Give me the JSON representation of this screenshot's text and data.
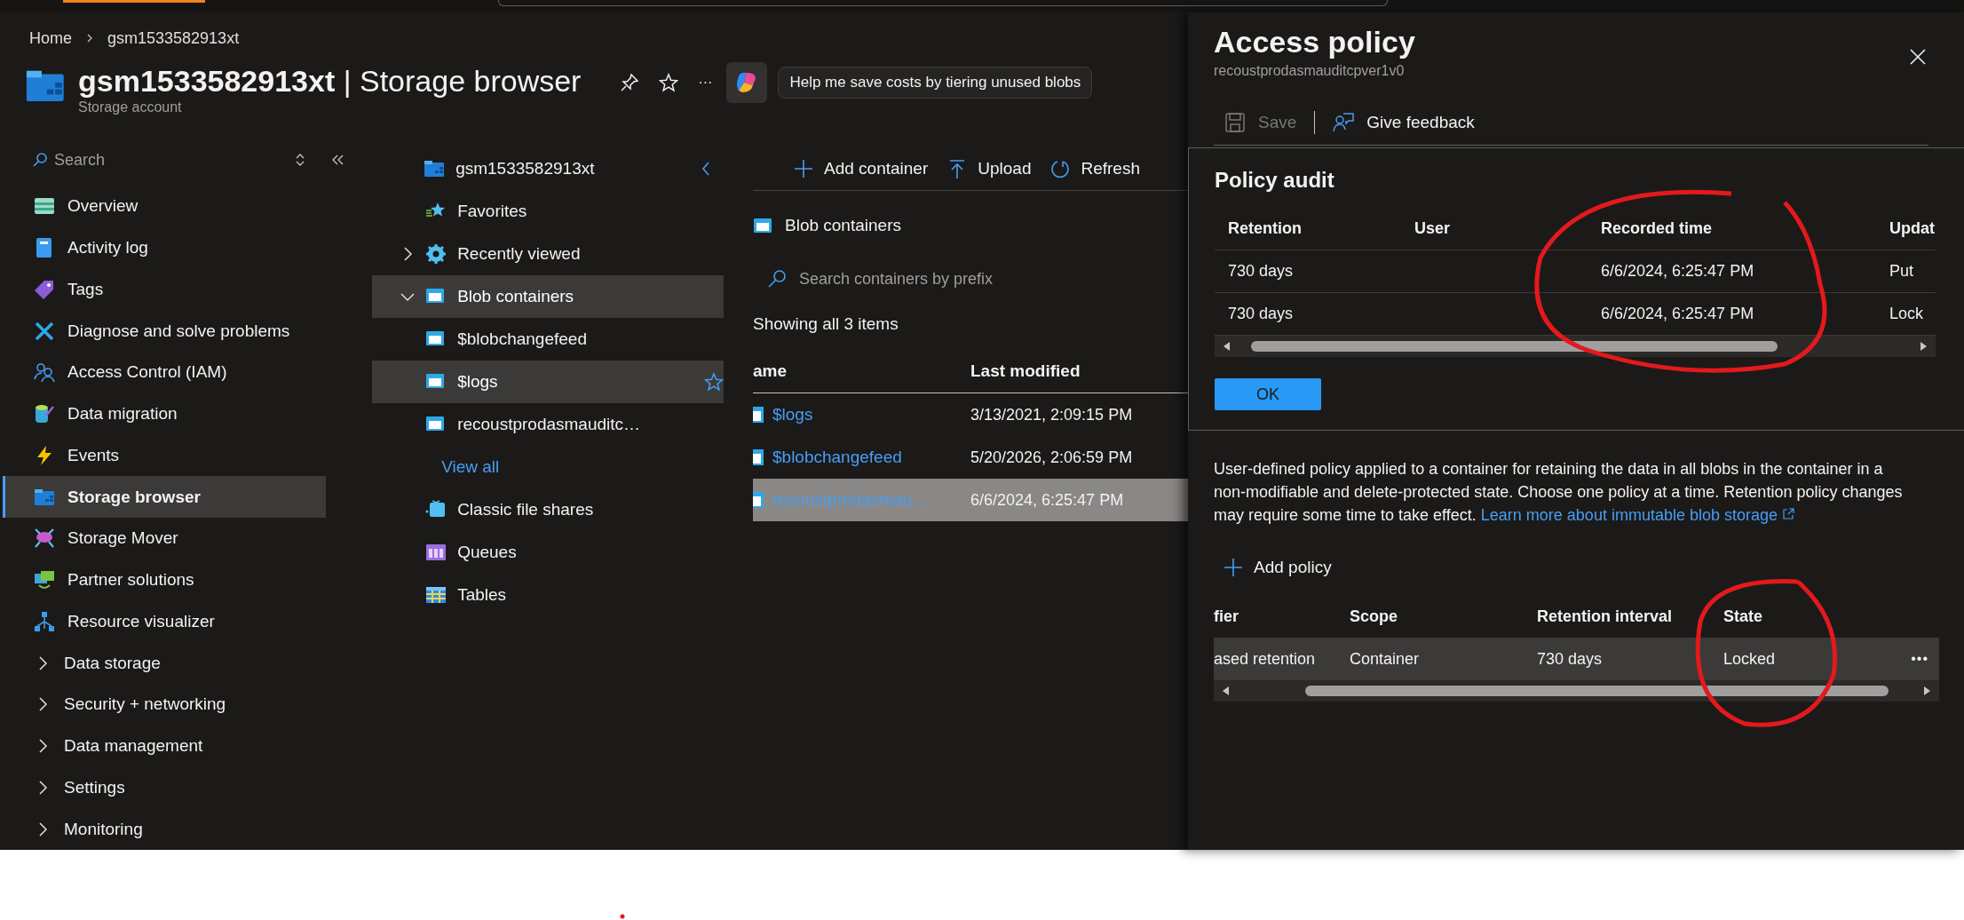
{
  "breadcrumb": [
    {
      "label": "Home"
    },
    {
      "label": "gsm1533582913xt"
    }
  ],
  "header": {
    "title_bold": "gsm1533582913xt",
    "title_rest": "| Storage browser",
    "subtitle": "Storage account",
    "ellipsis": "···",
    "suggestion": "Help me save costs by tiering unused blobs"
  },
  "sidebar": {
    "search": {
      "placeholder": "Search"
    },
    "items": [
      {
        "label": "Overview",
        "kind": "link",
        "selected": false
      },
      {
        "label": "Activity log",
        "kind": "link",
        "selected": false
      },
      {
        "label": "Tags",
        "kind": "link",
        "selected": false
      },
      {
        "label": "Diagnose and solve problems",
        "kind": "link",
        "selected": false
      },
      {
        "label": "Access Control (IAM)",
        "kind": "link",
        "selected": false
      },
      {
        "label": "Data migration",
        "kind": "link",
        "selected": false
      },
      {
        "label": "Events",
        "kind": "link",
        "selected": false
      },
      {
        "label": "Storage browser",
        "kind": "link",
        "selected": true
      },
      {
        "label": "Storage Mover",
        "kind": "link",
        "selected": false
      },
      {
        "label": "Partner solutions",
        "kind": "link",
        "selected": false
      },
      {
        "label": "Resource visualizer",
        "kind": "link",
        "selected": false
      },
      {
        "label": "Data storage",
        "kind": "group",
        "expanded": false,
        "selected": false
      },
      {
        "label": "Security + networking",
        "kind": "group",
        "expanded": false,
        "selected": false
      },
      {
        "label": "Data management",
        "kind": "group",
        "expanded": false,
        "selected": false
      },
      {
        "label": "Settings",
        "kind": "group",
        "expanded": false,
        "selected": false
      },
      {
        "label": "Monitoring",
        "kind": "group",
        "expanded": false,
        "selected": false
      }
    ]
  },
  "tree": {
    "label": "gsm1533582913xt",
    "children": [
      {
        "label": "Favorites",
        "kind": "favorites",
        "selected": false
      },
      {
        "label": "Recently viewed",
        "kind": "recent",
        "expanded": false,
        "selected": false
      },
      {
        "label": "Blob containers",
        "kind": "blob",
        "expanded": true,
        "selected": true,
        "children": [
          {
            "label": "$blobchangefeed",
            "kind": "container",
            "selected": false,
            "hovered": false
          },
          {
            "label": "$logs",
            "kind": "container",
            "selected": true,
            "hovered": true
          },
          {
            "label": "recoustprodasmauditc…",
            "kind": "container",
            "selected": false,
            "hovered": false
          },
          {
            "label": "View all",
            "kind": "link"
          }
        ]
      },
      {
        "label": "Classic file shares",
        "kind": "files",
        "selected": false
      },
      {
        "label": "Queues",
        "kind": "queues",
        "selected": false
      },
      {
        "label": "Tables",
        "kind": "tables",
        "selected": false
      }
    ]
  },
  "toolbar": [
    {
      "label": "Add container",
      "kind": "add"
    },
    {
      "label": "Upload",
      "kind": "upload"
    },
    {
      "label": "Refresh",
      "kind": "refresh"
    }
  ],
  "content": {
    "heading": "Blob containers",
    "search": {
      "placeholder": "Search containers by prefix"
    },
    "count": "Showing all 3 items",
    "table": {
      "columns": [
        "ame",
        "Last modified"
      ],
      "rows": [
        {
          "name": "$logs",
          "last_modified": "3/13/2021, 2:09:15 PM",
          "selected": false
        },
        {
          "name": "$blobchangefeed",
          "last_modified": "5/20/2026, 2:06:59 PM",
          "selected": false
        },
        {
          "name": "recoustprodasmau…",
          "last_modified": "6/6/2024, 6:25:47 PM",
          "selected": true
        }
      ]
    }
  },
  "panel": {
    "title": "Access policy",
    "subtitle": "recoustprodasmauditcpver1v0",
    "actions": [
      {
        "label": "Save",
        "kind": "save",
        "disabled": true
      },
      {
        "label": "Give feedback",
        "kind": "feedback",
        "disabled": false
      }
    ],
    "audit": {
      "title": "Policy audit",
      "columns": [
        "Retention",
        "User",
        "Recorded time",
        "Updat"
      ],
      "rows": [
        {
          "retention": "730 days",
          "recorded_time": "6/6/2024, 6:25:47 PM",
          "column_4": "Put"
        },
        {
          "retention": "730 days",
          "recorded_time": "6/6/2024, 6:25:47 PM",
          "column_4": "Lock"
        }
      ],
      "ok": "OK"
    },
    "description": "User-defined policy applied to a container for retaining the data in all blobs in the container in a non-modifiable and delete-protected state. Choose one policy at a time. Retention policy changes may require some time to take effect.",
    "learn_more": "Learn more about immutable blob storage",
    "add_policy": "Add policy",
    "policies": {
      "columns": [
        "fier",
        "Scope",
        "Retention interval",
        "State"
      ],
      "rows": [
        {
          "column_1": "ased retention",
          "scope": "Container",
          "retention_interval": "730 days",
          "state": "Locked",
          "more": "•••"
        }
      ]
    }
  },
  "annotations": [
    {
      "kind": "circle",
      "color": "#e3191c"
    },
    {
      "kind": "circle",
      "color": "#e3191c"
    },
    {
      "kind": "dot",
      "color": "#e3191c"
    }
  ]
}
